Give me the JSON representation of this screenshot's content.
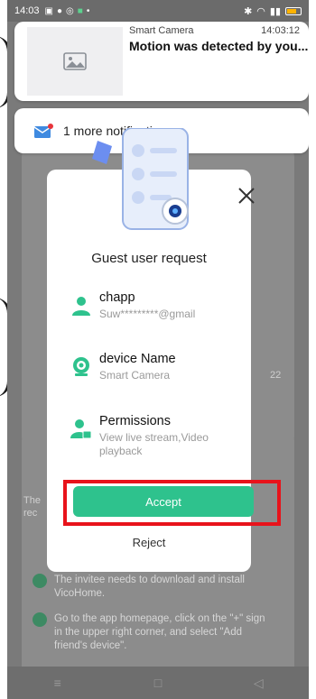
{
  "status_bar": {
    "time": "14:03"
  },
  "notification": {
    "app_name": "Smart Camera",
    "time": "14:03:12",
    "message": "Motion was detected by you..."
  },
  "more_notifications": {
    "label": "1 more notifications"
  },
  "background": {
    "step1": "The invitee needs to download and install VicoHome.",
    "step2": "Go to the app homepage, click on the \"+\" sign in the upper right corner, and select \"Add friend's device\".",
    "partial_text_1": "The",
    "partial_text_2": "rec",
    "partial_number": "22"
  },
  "modal": {
    "title": "Guest user request",
    "user": {
      "name": "chapp",
      "email": "Suw*********@gmail"
    },
    "device": {
      "label": "device Name",
      "value": "Smart Camera"
    },
    "permissions": {
      "label": "Permissions",
      "value": "View live stream,Video playback"
    },
    "accept_label": "Accept",
    "reject_label": "Reject"
  },
  "colors": {
    "accent": "#2ec28d",
    "highlight": "#e8131b"
  },
  "icons": {
    "user": "person-icon",
    "device": "camera-icon",
    "permissions": "person-lock-icon",
    "close": "close-icon",
    "notification_thumb": "image-icon",
    "mail": "mail-icon"
  }
}
